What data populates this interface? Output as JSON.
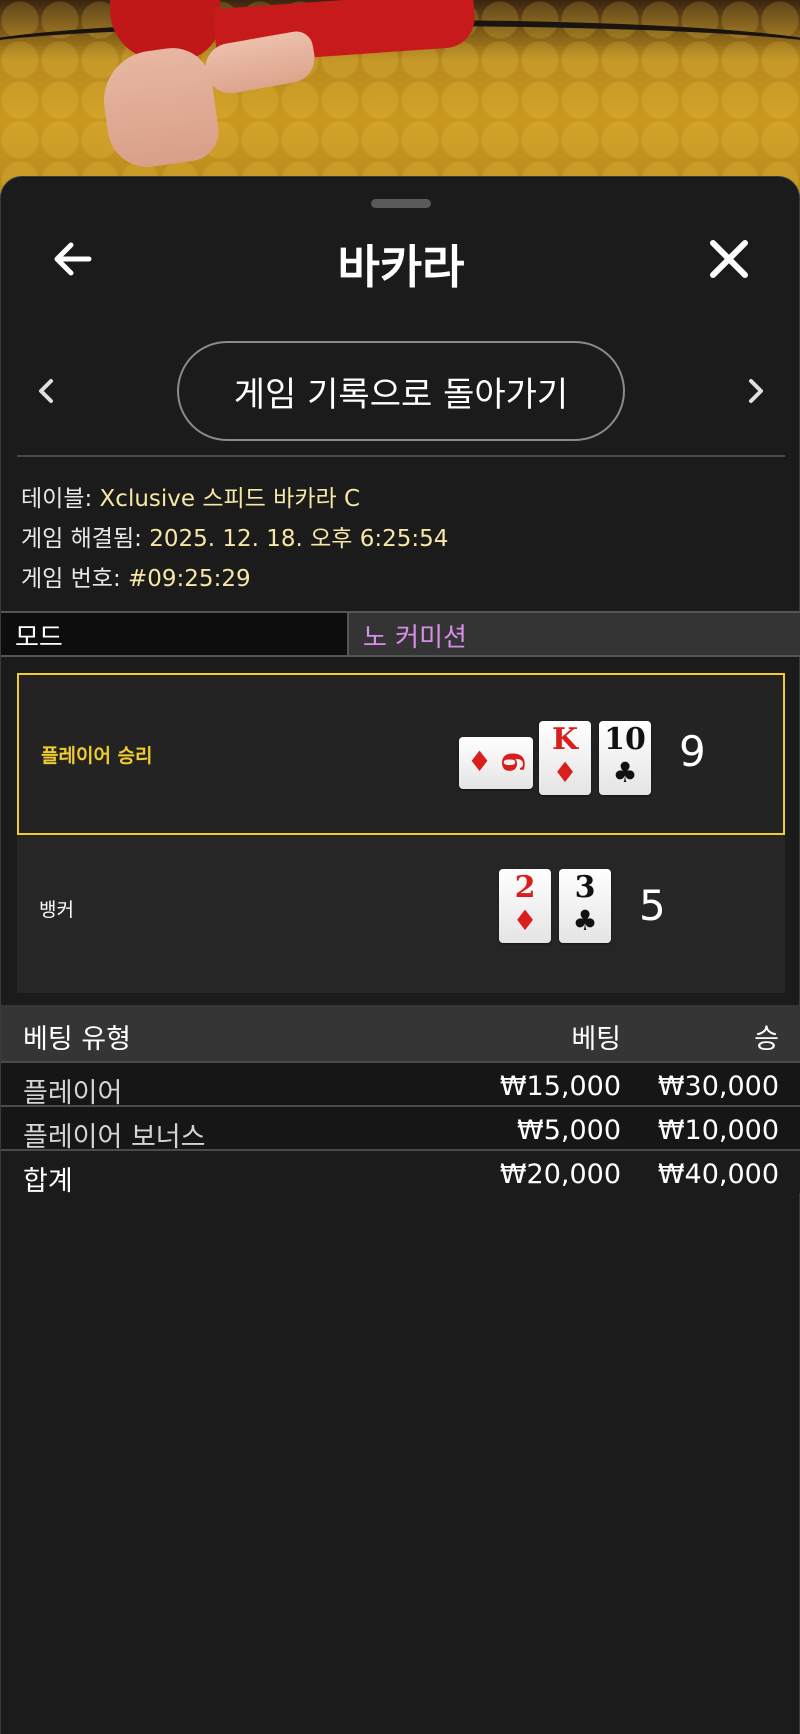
{
  "header": {
    "title": "바카라"
  },
  "nav": {
    "back_to_history_label": "게임 기록으로 돌아가기"
  },
  "info": {
    "table_label": "테이블:",
    "table_value": "Xclusive 스피드 바카라 C",
    "resolved_label": "게임 해결됨:",
    "resolved_value": "2025. 12. 18. 오후 6:25:54",
    "game_no_label": "게임 번호:",
    "game_no_value": "#09:25:29"
  },
  "mode": {
    "label": "모드",
    "value": "노 커미션"
  },
  "player": {
    "label": "플레이어 승리",
    "score": "9",
    "cards": [
      {
        "rank": "6",
        "suit": "♦",
        "color": "red",
        "sideways": true
      },
      {
        "rank": "K",
        "suit": "♦",
        "color": "red",
        "sideways": false
      },
      {
        "rank": "10",
        "suit": "♣",
        "color": "black",
        "sideways": false
      }
    ]
  },
  "banker": {
    "label": "뱅커",
    "score": "5",
    "cards": [
      {
        "rank": "2",
        "suit": "♦",
        "color": "red",
        "sideways": false
      },
      {
        "rank": "3",
        "suit": "♣",
        "color": "black",
        "sideways": false
      }
    ]
  },
  "bets": {
    "headers": {
      "type": "베팅 유형",
      "bet": "베팅",
      "win": "승"
    },
    "rows": [
      {
        "type": "플레이어",
        "bet": "₩15,000",
        "win": "₩30,000"
      },
      {
        "type": "플레이어 보너스",
        "bet": "₩5,000",
        "win": "₩10,000"
      }
    ],
    "total": {
      "type": "합계",
      "bet": "₩20,000",
      "win": "₩40,000"
    }
  },
  "colors": {
    "winner_border": "#f0cc2e",
    "info_value": "#f7e7a6",
    "mode_value": "#d88de8",
    "card_red": "#d91e1e"
  }
}
